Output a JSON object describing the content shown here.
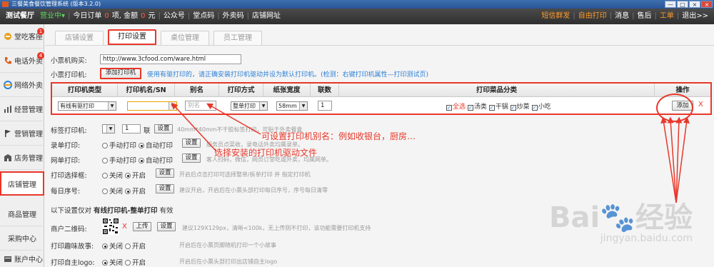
{
  "window": {
    "title": "三餐美食餐饮管理系统 (版本3.2.0)",
    "controls": [
      "—",
      "□",
      "×",
      "×"
    ]
  },
  "menubar": {
    "shop_name": "测试餐厅",
    "status": "营业中▾",
    "today_orders_label": "今日订单",
    "today_orders_count": "0",
    "orders_unit": "项, 金额",
    "amount": "0",
    "amount_unit": "元",
    "public_account": "公众号",
    "dine_code": "堂点码",
    "takeout_code": "外卖码",
    "store_url": "店铺网址",
    "sms": "短信群发",
    "free_print": "自由打印",
    "messages": "消息",
    "after_sale": "售后",
    "work": "工单",
    "exit": "退出>>"
  },
  "sidebar": {
    "items": [
      {
        "label": "堂吃客座",
        "badge": "1"
      },
      {
        "label": "电话外卖",
        "badge": "4"
      },
      {
        "label": "网络外卖"
      },
      {
        "label": "经营管理"
      },
      {
        "label": "营销管理"
      },
      {
        "label": "店务管理"
      },
      {
        "label": "店铺管理"
      },
      {
        "label": "商品管理"
      },
      {
        "label": "采购中心"
      },
      {
        "label": "账户中心"
      }
    ]
  },
  "tabs": [
    "店铺设置",
    "打印设置",
    "桌位管理",
    "员工管理"
  ],
  "form": {
    "buy_label": "小票机购买:",
    "buy_url": "http://www.3cfood.com/ware.html",
    "printer_label": "小票打印机:",
    "add_printer": "添加打印机",
    "printer_hint": "使用有驱打印的，请正确安装打印机驱动并设为默认打印机。(检测：右键打印机属性—打印测试页)",
    "table": {
      "headers": [
        "打印机类型",
        "打印机名/SN",
        "别名",
        "打印方式",
        "纸张宽度",
        "联数",
        "打印菜品分类",
        "操作"
      ],
      "row": {
        "type": "有线有驱打印",
        "name": "",
        "alias_placeholder": "别名",
        "method": "整单打印",
        "width": "58mm",
        "copies": "1",
        "categories": [
          "全选",
          "汤类",
          "干锅",
          "炒菜",
          "小吃"
        ],
        "add": "添加",
        "remove": "X"
      }
    },
    "label_printer": {
      "label": "标签打印机:",
      "copies": "1",
      "unit": "联",
      "btn": "设置",
      "hint": "40mm*40mm不干胶标签打印，可贴于外卖餐盒"
    },
    "entry_print": {
      "label": "录单打印:",
      "opt1": "手动打印",
      "opt2": "自动打印",
      "btn": "设置",
      "hint": "服务员点菜收，录电话外卖均属录单。"
    },
    "net_print": {
      "label": "网单打印:",
      "opt1": "手动打印",
      "opt2": "自动打印",
      "btn": "设置",
      "hint": "客人扫码，微信，网页订堂吃或外卖，均属网单。"
    },
    "select_box": {
      "label": "打印选择框:",
      "opt1": "关闭",
      "opt2": "开启",
      "btn": "设置",
      "hint": "开启后点击打印可选择整单/拆单打印 并 指定打印机"
    },
    "daily_seq": {
      "label": "每日序号:",
      "opt1": "关闭",
      "opt2": "开启",
      "btn": "设置",
      "hint": "建议开启，开启后在小票头部打印每日序号，序号每日清零"
    },
    "section_title_pre": "以下设置仅对",
    "section_title_bold": "有线打印机-整单打印",
    "section_title_post": "有效",
    "qr": {
      "label": "商户二维码:",
      "remove": "X",
      "upload": "上传",
      "btn": "设置",
      "hint": "建议129X129px，清晰<100k，无上传则不打印，该功能需要打印机支持"
    },
    "story": {
      "label": "打印趣味故事:",
      "opt1": "关闭",
      "opt2": "开启",
      "hint": "开启后在小票页脚随机打印一个小故事"
    },
    "logo": {
      "label": "打印自主logo:",
      "opt1": "关闭",
      "opt2": "开启",
      "hint": "开启后在小票头部打印出店铺自主logo"
    }
  },
  "annotations": {
    "alias": "可设置打印机别名：例如收银台，厨房…",
    "driver": "选择安装的打印机驱动文件"
  },
  "watermark": {
    "brand": "Bai",
    "brand2": "经验",
    "url": "jingyan.baidu.com"
  },
  "colors": {
    "accent_red": "#e8372a",
    "hint_blue": "#2c7fd6",
    "menubar": "#2f2f2f"
  }
}
